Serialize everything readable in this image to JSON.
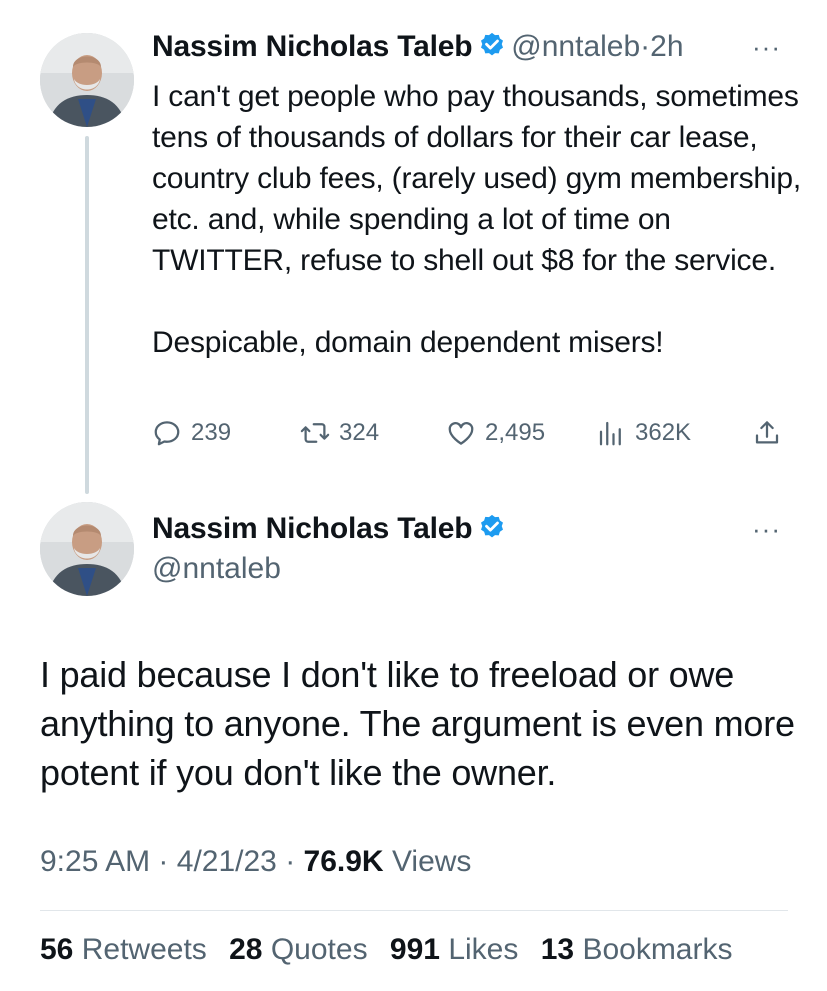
{
  "colors": {
    "text": "#0f1419",
    "secondary": "#536471",
    "verified_blue": "#1d9bf0",
    "thread_line": "#cfd9de"
  },
  "reply_tweet": {
    "author_name": "Nassim Nicholas Taleb",
    "handle": "@nntaleb",
    "separator": "·",
    "age": "2h",
    "more_icon": "more-horizontal-icon",
    "paragraphs": [
      "I can't get people who pay thousands, sometimes tens of thousands of dollars for their car lease, country club fees, (rarely used) gym membership, etc. and, while spending a lot of time on TWITTER, refuse to shell out $8 for the service.",
      "Despicable, domain dependent misers!"
    ],
    "actions": {
      "replies": "239",
      "retweets": "324",
      "likes": "2,495",
      "views": "362K"
    }
  },
  "main_tweet": {
    "author_name": "Nassim Nicholas Taleb",
    "handle": "@nntaleb",
    "more_icon": "more-horizontal-icon",
    "text": "I paid because I don't like to freeload or owe anything to anyone. The argument is even more potent if you don't like the owner.",
    "time": "9:25 AM",
    "date": "4/21/23",
    "separator": "·",
    "views_count": "76.9K",
    "views_label": "Views",
    "stats": {
      "retweets_count": "56",
      "retweets_label": "Retweets",
      "quotes_count": "28",
      "quotes_label": "Quotes",
      "likes_count": "991",
      "likes_label": "Likes",
      "bookmarks_count": "13",
      "bookmarks_label": "Bookmarks"
    }
  }
}
